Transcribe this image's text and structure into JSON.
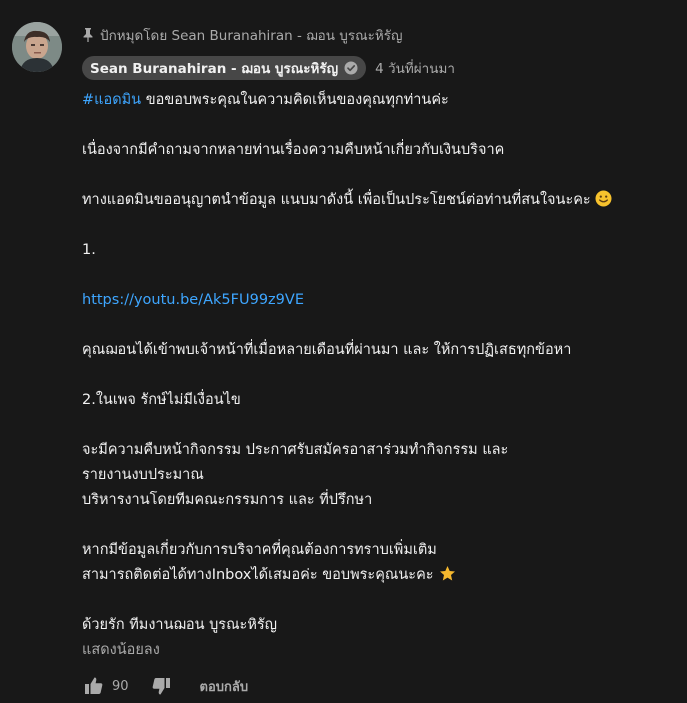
{
  "comment": {
    "pinned_text": "ปักหมุดโดย Sean Buranahiran - ฌอน บูรณะหิรัญ",
    "author": "Sean Buranahiran - ฌอน บูรณะหิรัญ",
    "timestamp": "4 วันที่ผ่านมา",
    "body": {
      "hashtag": "#แอดมิน",
      "line1_rest": " ขอขอบพระคุณในความคิดเห็นของคุณทุกท่านค่ะ",
      "line2": "เนื่องจากมีคำถามจากหลายท่านเรื่องความคืบหน้าเกี่ยวกับเงินบริจาค",
      "line3": "ทางแอดมินขออนุญาตนำข้อมูล แนบมาดังนี้ เพื่อเป็นประโยชน์ต่อท่านที่สนใจนะคะ",
      "line4": "1.",
      "link": "https://youtu.be/Ak5FU99z9VE",
      "line5": "คุณฌอนได้เข้าพบเจ้าหน้าที่เมื่อหลายเดือนที่ผ่านมา และ ให้การปฏิเสธทุกข้อหา",
      "line6": "2.ในเพจ รักษ์ไม่มีเงื่อนไข",
      "line7": "จะมีความคืบหน้ากิจกรรม ประกาศรับสมัครอาสาร่วมทำกิจกรรม และ",
      "line8": "รายงานงบประมาณ",
      "line9": "บริหารงานโดยทีมคณะกรรมการ และ ที่ปรึกษา",
      "line10": "หากมีข้อมูลเกี่ยวกับการบริจาคที่คุณต้องการทราบเพิ่มเติม",
      "line11": "สามารถติดต่อได้ทางInboxได้เสมอค่ะ ขอบพระคุณนะคะ",
      "line12": "ด้วยรัก ทีมงานฌอน บูรณะหิรัญ"
    },
    "show_less_label": "แสดงน้อยลง",
    "like_count": "90",
    "reply_label": "ตอบกลับ"
  },
  "icons": {
    "pin": "pin-icon",
    "verified": "verified-check-icon",
    "smile": "smiling-face-emoji",
    "star": "star-emoji",
    "like": "thumbs-up-icon",
    "dislike": "thumbs-down-icon"
  },
  "colors": {
    "background": "#181818",
    "text": "#f1f1f1",
    "secondary_text": "#aaaaaa",
    "link": "#3ea6ff",
    "author_chip": "#474747"
  }
}
